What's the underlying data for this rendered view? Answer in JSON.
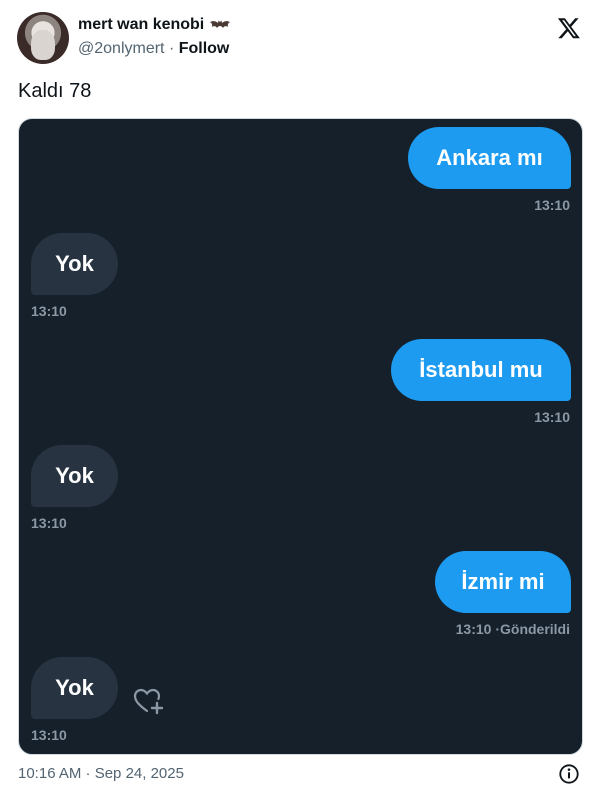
{
  "author": {
    "display_name": "mert wan kenobi",
    "emoji_icon": "bat-icon",
    "handle": "@2onlymert",
    "separator": " · ",
    "follow_label": "Follow"
  },
  "platform_icon": "x-logo-icon",
  "tweet_text": "Kaldı 78",
  "chat": {
    "background": "#15202b",
    "outgoing_color": "#1d9bf0",
    "incoming_color": "#273340",
    "messages": [
      {
        "direction": "out",
        "text": "Ankara mı",
        "time": "13:10"
      },
      {
        "direction": "in",
        "text": "Yok",
        "time": "13:10"
      },
      {
        "direction": "out",
        "text": "İstanbul mu",
        "time": "13:10"
      },
      {
        "direction": "in",
        "text": "Yok",
        "time": "13:10"
      },
      {
        "direction": "out",
        "text": "İzmir mi",
        "time": "13:10 ·Gönderildi"
      },
      {
        "direction": "in",
        "text": "Yok",
        "time": "13:10"
      }
    ],
    "reaction_icon": "heart-add-icon"
  },
  "footer": {
    "timestamp": "10:16 AM · Sep 24, 2025",
    "info_icon": "info-icon"
  }
}
